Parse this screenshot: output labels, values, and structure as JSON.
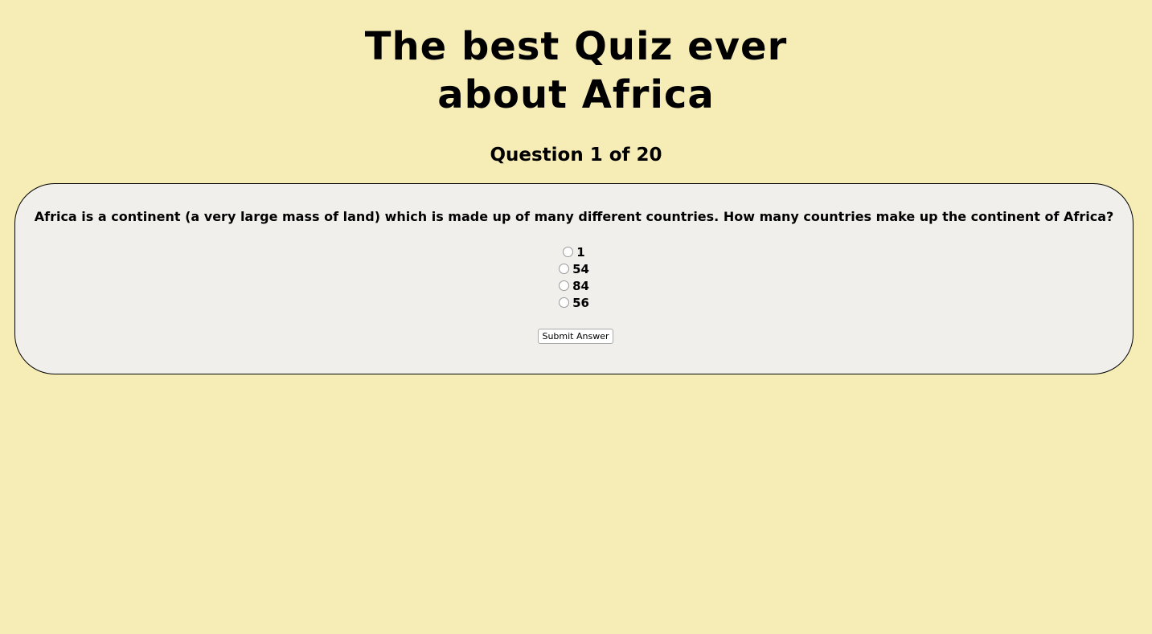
{
  "page": {
    "title_line1": "The best Quiz ever",
    "title_line2": "about Africa",
    "counter": "Question 1 of 20"
  },
  "quiz": {
    "question": "Africa is a continent (a very large mass of land) which is made up of many different countries. How many countries make up the continent of Africa?",
    "options": [
      "1",
      "54",
      "84",
      "56"
    ],
    "submit_label": "Submit Answer"
  },
  "colors": {
    "background": "#f6ecb5",
    "card": "#f0efeb",
    "text": "#000000"
  }
}
